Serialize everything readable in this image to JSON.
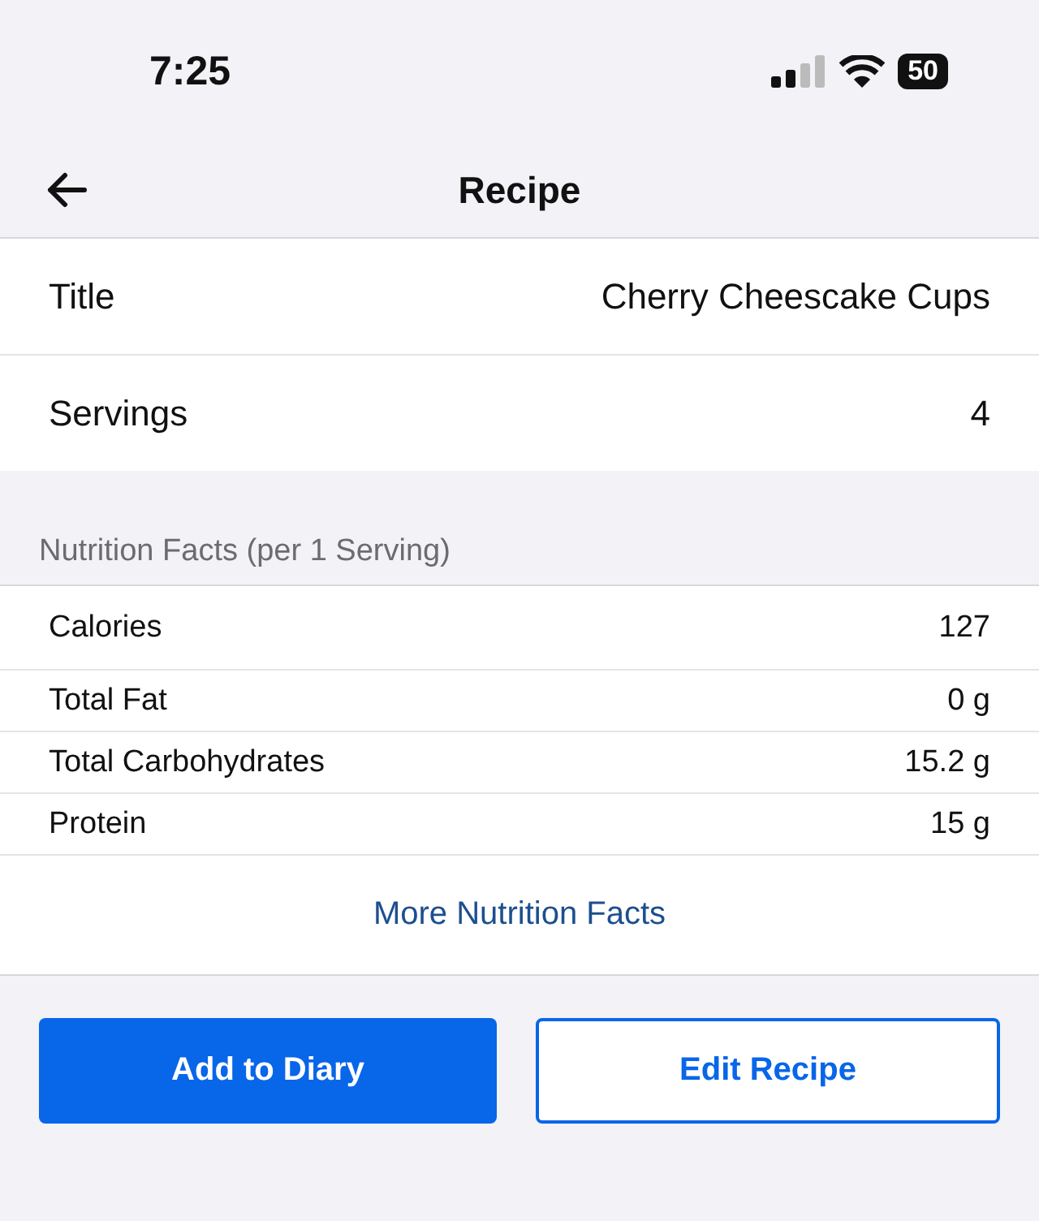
{
  "status_bar": {
    "time": "7:25",
    "battery": "50"
  },
  "nav": {
    "title": "Recipe"
  },
  "recipe": [
    {
      "label": "Title",
      "value": "Cherry Cheescake Cups"
    },
    {
      "label": "Servings",
      "value": "4"
    }
  ],
  "nutrition": {
    "header": "Nutrition Facts (per 1 Serving)",
    "rows": [
      {
        "label": "Calories",
        "value": "127"
      },
      {
        "label": "Total Fat",
        "value": "0 g"
      },
      {
        "label": "Total Carbohydrates",
        "value": "15.2 g"
      },
      {
        "label": "Protein",
        "value": "15 g"
      }
    ],
    "more_link": "More Nutrition Facts"
  },
  "buttons": [
    {
      "label": "Add to Diary",
      "kind": "primary"
    },
    {
      "label": "Edit Recipe",
      "kind": "outline"
    }
  ]
}
